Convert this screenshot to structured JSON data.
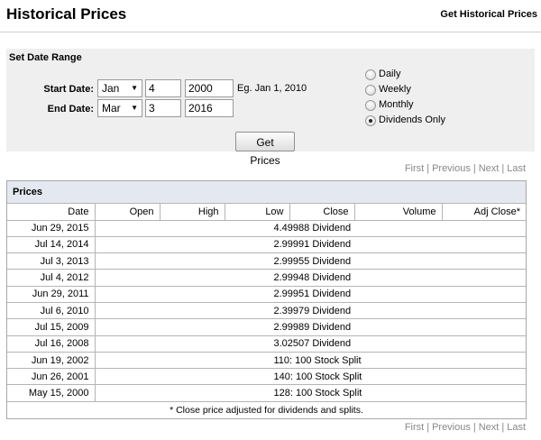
{
  "header": {
    "title": "Historical Prices",
    "link": "Get Historical Prices"
  },
  "date_range": {
    "title": "Set Date Range",
    "start_label": "Start Date:",
    "start_month": "Jan",
    "start_day": "4",
    "start_year": "2000",
    "example": "Eg. Jan 1, 2010",
    "end_label": "End Date:",
    "end_month": "Mar",
    "end_day": "3",
    "end_year": "2016",
    "frequency_options": [
      "Daily",
      "Weekly",
      "Monthly",
      "Dividends Only"
    ],
    "selected_frequency": "Dividends Only",
    "button": "Get Prices"
  },
  "pager": {
    "first": "First",
    "previous": "Previous",
    "next": "Next",
    "last": "Last"
  },
  "prices": {
    "title": "Prices",
    "columns": [
      "Date",
      "Open",
      "High",
      "Low",
      "Close",
      "Volume",
      "Adj Close*"
    ],
    "rows": [
      {
        "date": "Jun 29, 2015",
        "value": "4.49988 Dividend"
      },
      {
        "date": "Jul 14, 2014",
        "value": "2.99991 Dividend"
      },
      {
        "date": "Jul 3, 2013",
        "value": "2.99955 Dividend"
      },
      {
        "date": "Jul 4, 2012",
        "value": "2.99948 Dividend"
      },
      {
        "date": "Jun 29, 2011",
        "value": "2.99951 Dividend"
      },
      {
        "date": "Jul 6, 2010",
        "value": "2.39979 Dividend"
      },
      {
        "date": "Jul 15, 2009",
        "value": "2.99989 Dividend"
      },
      {
        "date": "Jul 16, 2008",
        "value": "3.02507 Dividend"
      },
      {
        "date": "Jun 19, 2002",
        "value": "110: 100 Stock Split"
      },
      {
        "date": "Jun 26, 2001",
        "value": "140: 100 Stock Split"
      },
      {
        "date": "May 15, 2000",
        "value": "128: 100 Stock Split"
      }
    ],
    "footnote": "* Close price adjusted for dividends and splits."
  }
}
